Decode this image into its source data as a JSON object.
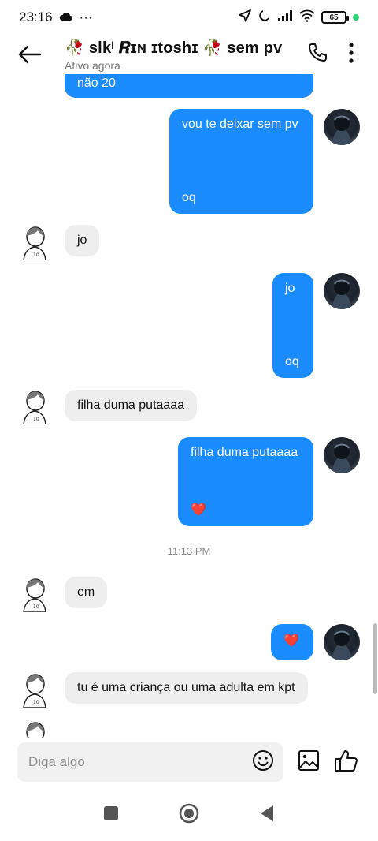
{
  "status_bar": {
    "time": "23:16",
    "dots": "···",
    "battery": "65"
  },
  "header": {
    "title": "🥀 slkᴵ 𝑹ɪɴ ɪtoshɪ 🥀  sem pv",
    "subtitle": "Ativo agora"
  },
  "messages": [
    {
      "from": "me",
      "text": "não 20"
    },
    {
      "from": "me",
      "line1": "vou te deixar sem pv",
      "line2": "oq"
    },
    {
      "from": "them",
      "text": "jo"
    },
    {
      "from": "me",
      "line1": "jo",
      "line2": "oq"
    },
    {
      "from": "them",
      "text": "filha duma putaaaa"
    },
    {
      "from": "me",
      "line1": "filha duma putaaaa",
      "line2": "❤️"
    },
    {
      "from": "them",
      "text": "em"
    },
    {
      "from": "me",
      "text": "❤️"
    },
    {
      "from": "them",
      "text": "tu é uma criança ou uma adulta em kpt"
    }
  ],
  "timestamp": "11:13 PM",
  "composer": {
    "placeholder": "Diga algo"
  },
  "colors": {
    "accent": "#1a8cff",
    "incoming": "#eeeeee",
    "heart": "#e0233b"
  }
}
